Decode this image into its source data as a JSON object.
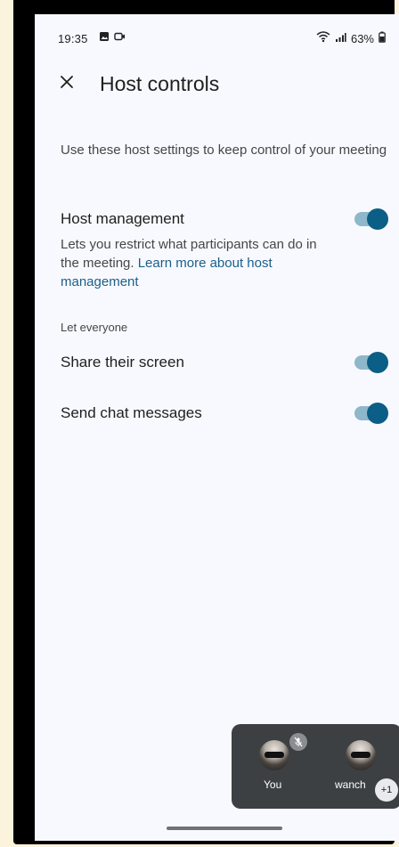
{
  "status_bar": {
    "time": "19:35",
    "battery": "63%",
    "left_icons": [
      "gallery-icon",
      "video-icon"
    ],
    "right_icons": [
      "wifi-icon",
      "signal-icon",
      "battery-icon"
    ]
  },
  "app_bar": {
    "close_icon": "close-icon",
    "title": "Host controls"
  },
  "intro_text": "Use these host settings to keep control of your meeting",
  "host_management": {
    "title": "Host management",
    "description": "Lets you restrict what participants can do in the meeting. ",
    "link_text": "Learn more about host management",
    "enabled": true
  },
  "section_label": "Let everyone",
  "settings": [
    {
      "label": "Share their screen",
      "enabled": true
    },
    {
      "label": "Send chat messages",
      "enabled": true
    }
  ],
  "pip": {
    "participants": [
      {
        "name": "You",
        "muted": true
      },
      {
        "name": "wanch"
      }
    ],
    "more_count": "+1"
  },
  "colors": {
    "toggle_on": "#0b5e85",
    "toggle_track": "#8fb7cb",
    "link": "#1a5f8a",
    "background": "#f8f9fe"
  }
}
